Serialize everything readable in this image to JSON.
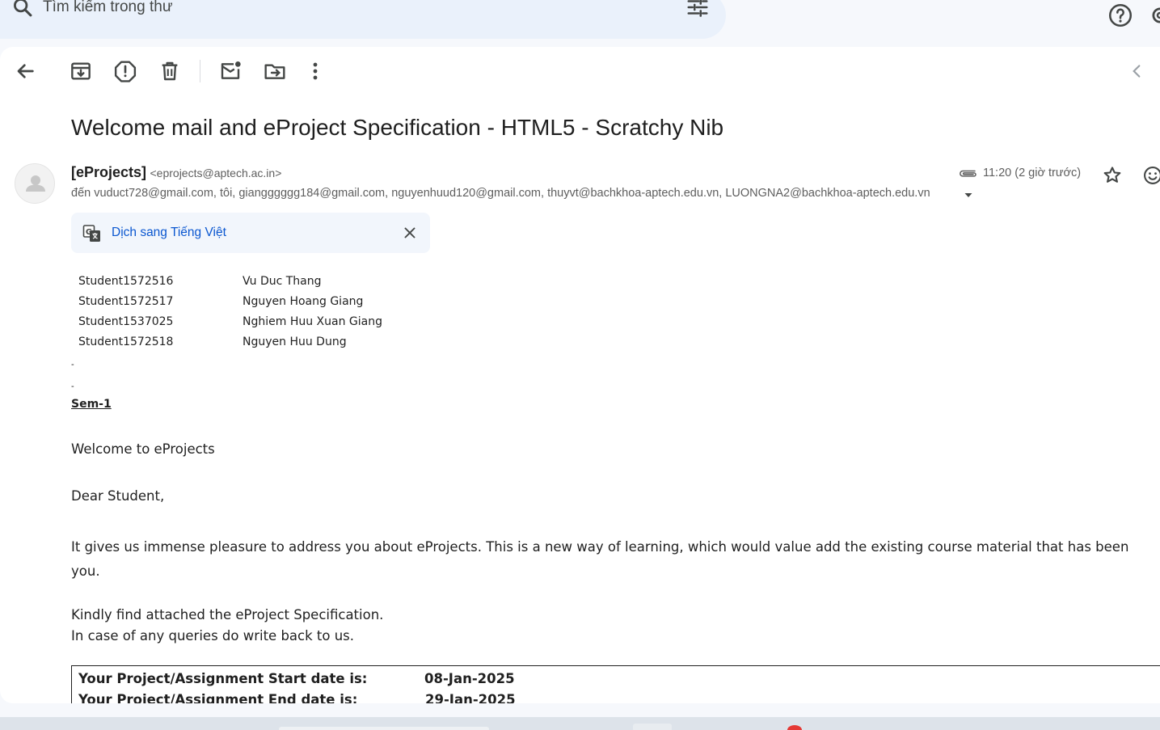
{
  "search": {
    "placeholder": "Tìm kiếm trong thư"
  },
  "message": {
    "subject": "Welcome mail and eProject Specification - HTML5 - Scratchy Nib",
    "sender_name": "[eProjects]",
    "sender_email": "<eprojects@aptech.ac.in>",
    "recipients": "đến vuduct728@gmail.com, tôi, giangggggg184@gmail.com, nguyenhuud120@gmail.com, thuyvt@bachkhoa-aptech.edu.vn, LUONGNA2@bachkhoa-aptech.edu.vn",
    "time": "11:20 (2 giờ trước)"
  },
  "translate": {
    "label": "Dịch sang Tiếng Việt"
  },
  "body": {
    "students": [
      {
        "id": "Student1572516",
        "name": "Vu Duc Thang"
      },
      {
        "id": "Student1572517",
        "name": "Nguyen Hoang Giang"
      },
      {
        "id": "Student1537025",
        "name": "Nghiem Huu Xuan Giang"
      },
      {
        "id": "Student1572518",
        "name": "Nguyen Huu Dung"
      }
    ],
    "dash": "-",
    "semester": "Sem-1",
    "welcome": "Welcome to eProjects",
    "greeting": "Dear Student,",
    "paragraph_line1": "It gives us immense pleasure to address you about eProjects. This is a new way of learning, which would value add the existing course material that has been",
    "paragraph_line2": "you.",
    "attached_line": "Kindly find attached the eProject Specification.",
    "queries_line": "In case of any queries do write back to us.",
    "start_label": "Your Project/Assignment Start date is:",
    "start_date": "08-Jan-2025",
    "end_label": "Your Project/Assignment End date is:",
    "end_date": "29-Jan-2025"
  },
  "icons": {
    "search": "search-icon",
    "filter": "tune-icon",
    "help": "help-icon",
    "settings": "gear-icon",
    "back": "arrow-back-icon",
    "archive": "archive-icon",
    "spam": "report-spam-icon",
    "delete": "trash-icon",
    "unread": "mark-unread-icon",
    "move": "move-to-icon",
    "more": "more-vert-icon",
    "prev": "chevron-left-icon"
  },
  "colors": {
    "link": "#0b57d0",
    "search_bg": "#eaf1fb",
    "page_bg": "#f6f8fc"
  }
}
